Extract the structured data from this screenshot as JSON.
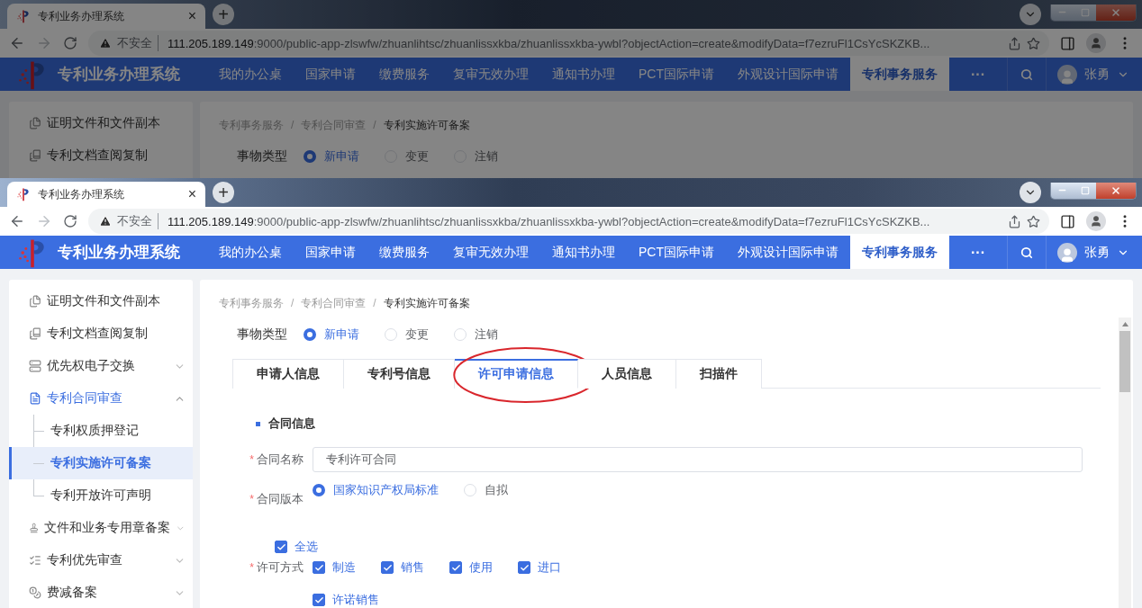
{
  "screens": [
    {
      "dimmed": true,
      "browser": {
        "tab_title": "专利业务办理系统",
        "tab_close": "×",
        "new_tab": "+",
        "security": "不安全",
        "url_host": "111.205.189.149",
        "url_rest": ":9000/public-app-zlswfw/zhuanlihtsc/zhuanlissxkba/zhuanlissxkba-ywbl?objectAction=create&modifyData=f7ezruFl1CsYcSKZKB..."
      },
      "app": {
        "title": "专利业务办理系统",
        "more": "···",
        "user": "张勇",
        "nav": [
          {
            "label": "我的办公桌",
            "selected": false
          },
          {
            "label": "国家申请",
            "selected": false
          },
          {
            "label": "缴费服务",
            "selected": false
          },
          {
            "label": "复审无效办理",
            "selected": false
          },
          {
            "label": "通知书办理",
            "selected": false
          },
          {
            "label": "PCT国际申请",
            "selected": false
          },
          {
            "label": "外观设计国际申请",
            "selected": false
          },
          {
            "label": "专利事务服务",
            "selected": true
          }
        ]
      },
      "sidebar": [
        {
          "label": "证明文件和文件副本"
        },
        {
          "label": "专利文档查阅复制"
        }
      ],
      "breadcrumb": [
        {
          "label": "专利事务服务",
          "sep": "/"
        },
        {
          "label": "专利合同审查",
          "sep": "/"
        },
        {
          "label": "专利实施许可备案"
        }
      ],
      "matter_type": {
        "label": "事物类型",
        "options": [
          {
            "label": "新申请",
            "selected": true
          },
          {
            "label": "变更",
            "selected": false
          },
          {
            "label": "注销",
            "selected": false
          }
        ]
      }
    },
    {
      "dimmed": false,
      "browser": {
        "tab_title": "专利业务办理系统",
        "tab_close": "×",
        "new_tab": "+",
        "security": "不安全",
        "url_host": "111.205.189.149",
        "url_rest": ":9000/public-app-zlswfw/zhuanlihtsc/zhuanlissxkba/zhuanlissxkba-ywbl?objectAction=create&modifyData=f7ezruFl1CsYcSKZKB..."
      },
      "app": {
        "title": "专利业务办理系统",
        "more": "···",
        "user": "张勇",
        "nav": [
          {
            "label": "我的办公桌",
            "selected": false
          },
          {
            "label": "国家申请",
            "selected": false
          },
          {
            "label": "缴费服务",
            "selected": false
          },
          {
            "label": "复审无效办理",
            "selected": false
          },
          {
            "label": "通知书办理",
            "selected": false
          },
          {
            "label": "PCT国际申请",
            "selected": false
          },
          {
            "label": "外观设计国际申请",
            "selected": false
          },
          {
            "label": "专利事务服务",
            "selected": true
          }
        ]
      },
      "sidebar": [
        {
          "label": "证明文件和文件副本"
        },
        {
          "label": "专利文档查阅复制"
        },
        {
          "label": "优先权电子交换",
          "expanded": false
        },
        {
          "label": "专利合同审查",
          "expanded": true,
          "children": [
            {
              "label": "专利权质押登记",
              "selected": false
            },
            {
              "label": "专利实施许可备案",
              "selected": true
            },
            {
              "label": "专利开放许可声明",
              "selected": false
            }
          ]
        },
        {
          "label": "文件和业务专用章备案",
          "expanded": false
        },
        {
          "label": "专利优先审查",
          "expanded": false
        },
        {
          "label": "费减备案",
          "expanded": false
        }
      ],
      "breadcrumb": [
        {
          "label": "专利事务服务",
          "sep": "/"
        },
        {
          "label": "专利合同审查",
          "sep": "/"
        },
        {
          "label": "专利实施许可备案"
        }
      ],
      "matter_type": {
        "label": "事物类型",
        "options": [
          {
            "label": "新申请",
            "selected": true
          },
          {
            "label": "变更",
            "selected": false
          },
          {
            "label": "注销",
            "selected": false
          }
        ]
      },
      "tabs": [
        {
          "label": "申请人信息",
          "selected": false,
          "circled": false
        },
        {
          "label": "专利号信息",
          "selected": false,
          "circled": false
        },
        {
          "label": "许可申请信息",
          "selected": true,
          "circled": true
        },
        {
          "label": "人员信息",
          "selected": false,
          "circled": false
        },
        {
          "label": "扫描件",
          "selected": false,
          "circled": false
        }
      ],
      "section": "合同信息",
      "fields": [
        {
          "kind": "text",
          "mark": "*",
          "label": "合同名称",
          "value": "专利许可合同"
        },
        {
          "kind": "radio",
          "mark": "*",
          "label": "合同版本",
          "options": [
            {
              "label": "国家知识产权局标准",
              "selected": true
            },
            {
              "label": "自拟",
              "selected": false
            }
          ]
        },
        {
          "kind": "select_all",
          "label": "全选",
          "checked": true
        },
        {
          "kind": "checkboxes",
          "mark": "*",
          "label": "许可方式",
          "options": [
            {
              "label": "制造",
              "checked": true
            },
            {
              "label": "销售",
              "checked": true
            },
            {
              "label": "使用",
              "checked": true
            },
            {
              "label": "进口",
              "checked": true
            },
            {
              "label": "许诺销售",
              "checked": true
            }
          ]
        }
      ]
    }
  ]
}
